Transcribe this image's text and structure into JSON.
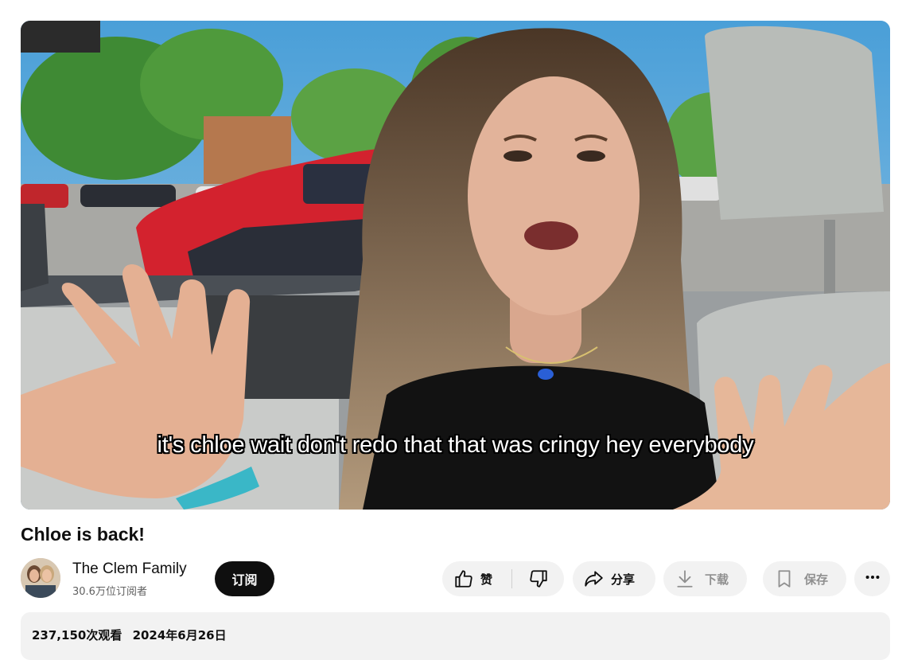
{
  "video": {
    "caption": "it's chloe wait don't redo that that was cringy hey everybody",
    "title": "Chloe is back!"
  },
  "channel": {
    "name": "The Clem Family",
    "subscribers": "30.6万位订阅者",
    "subscribe_label": "订阅"
  },
  "actions": {
    "like_label": "赞",
    "share_label": "分享",
    "download_label": "下载",
    "save_label": "保存"
  },
  "description": {
    "views": "237,150次观看",
    "date": "2024年6月26日"
  },
  "icons": {
    "like": "thumb-up-icon",
    "dislike": "thumb-down-icon",
    "share": "share-arrow-icon",
    "download": "download-icon",
    "save": "bookmark-icon",
    "more": "more-horizontal-icon"
  },
  "colors": {
    "subscribe_bg": "#0f0f0f",
    "pill_bg": "#f2f2f2",
    "secondary_text": "#606060"
  }
}
